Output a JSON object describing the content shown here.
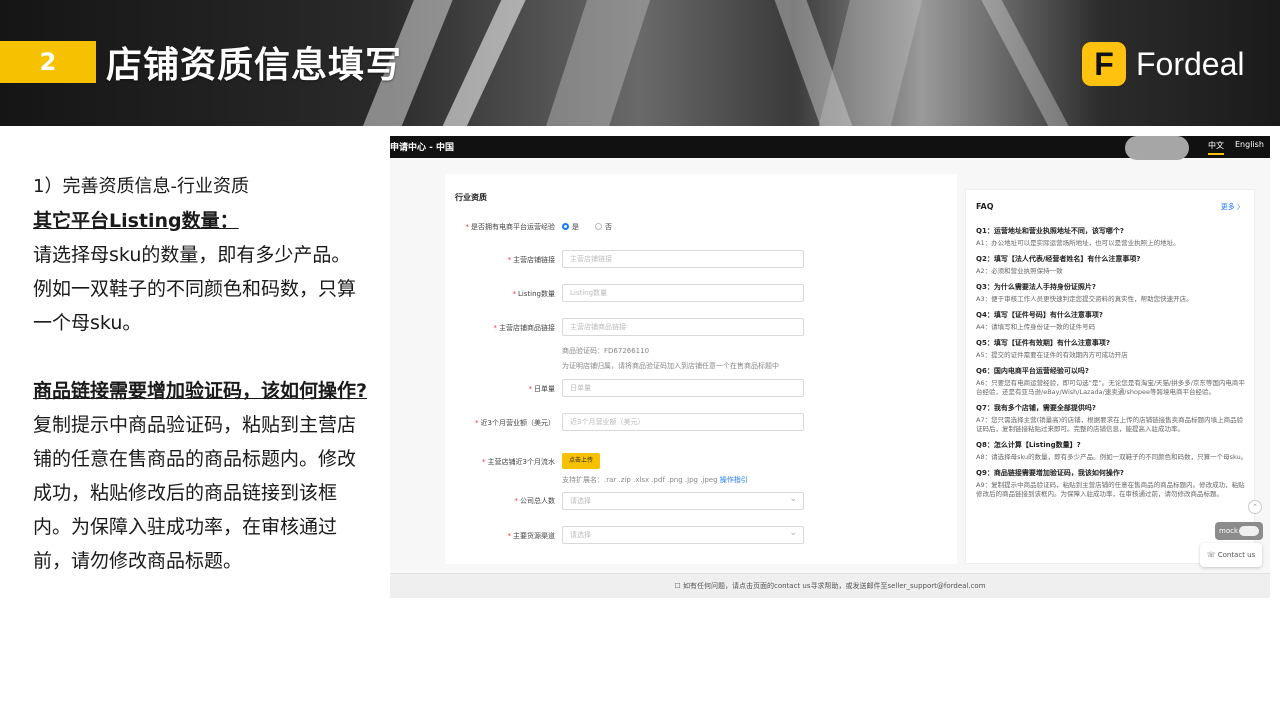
{
  "header": {
    "section_number": "2",
    "section_title": "店铺资质信息填写",
    "logo_mark": "F",
    "logo_text": "Fordeal",
    "accent_color": "#f6c200"
  },
  "left": {
    "subtitle": "1）完善资质信息-行业资质",
    "heading1": "其它平台Listing数量：",
    "body1": "请选择母sku的数量，即有多少产品。例如一双鞋子的不同颜色和码数，只算一个母sku。",
    "heading2": "商品链接需要增加验证码，该如何操作?",
    "body2": "复制提示中商品验证码，粘贴到主营店铺的任意在售商品的商品标题内。修改成功，粘贴修改后的商品链接到该框内。为保障入驻成功率，在审核通过前，请勿修改商品标题。"
  },
  "screenshot": {
    "topbar_title": "申请中心 - 中国",
    "lang_zh": "中文",
    "lang_en": "English",
    "form": {
      "section": "行业资质",
      "q_experience": "是否拥有电商平台运营经验",
      "yes": "是",
      "no": "否",
      "store_link_label": "主营店铺链接",
      "store_link_ph": "主营店铺链接",
      "listing_label": "Listing数量",
      "listing_ph": "Listing数量",
      "product_link_label": "主营店铺商品链接",
      "product_link_ph": "主营店铺商品链接",
      "verify_code": "商品验证码：FD67266110",
      "verify_hint": "为证明店铺归属，请将商品验证码加入到店铺任意一个在售商品标题中",
      "daily_orders_label": "日单量",
      "daily_orders_ph": "日单量",
      "revenue_label": "近3个月营业额（美元）",
      "revenue_ph": "近3个月营业额（美元）",
      "statement_label": "主营店铺近3个月流水",
      "upload_btn": "点击上传",
      "ext_hint": "支持扩展名：.rar .zip .xlsx .pdf .png .jpg .jpeg",
      "ext_link": "操作指引",
      "staff_label": "公司总人数",
      "staff_ph": "请选择",
      "channel_label": "主要货源渠道",
      "channel_ph": "请选择"
    },
    "faq": {
      "title": "FAQ",
      "more": "更多 〉",
      "items": [
        {
          "q": "Q1：运营地址和营业执照地址不同，该写哪个?",
          "a": "A1：办公地址可以是实际运营场所地址，也可以是营业执照上的地址。"
        },
        {
          "q": "Q2：填写【法人代表/经营者姓名】有什么注意事项?",
          "a": "A2：必须和营业执照保持一致"
        },
        {
          "q": "Q3：为什么需要法人手持身份证照片?",
          "a": "A3：便于审核工作人员更快速判定您提交资料的真实性，帮助您快速开店。"
        },
        {
          "q": "Q4：填写【证件号码】有什么注意事项?",
          "a": "A4：请填写和上传身份证一致的证件号码"
        },
        {
          "q": "Q5：填写【证件有效期】有什么注意事项?",
          "a": "A5：提交的证件需要在证件的有效期内方可成功开店"
        },
        {
          "q": "Q6：国内电商平台运营经验可以吗?",
          "a": "A6：只要您有电商运营经验，即可勾选“是”。无论您是有淘宝/天猫/拼多多/京东等国内电商平台经验，还是有亚马逊/eBay/Wish/Lazada/速卖通/shopee等跨境电商平台经验。"
        },
        {
          "q": "Q7：我有多个店铺，需要全部提供吗?",
          "a": "A7：您只需选择主营(销量高)的店铺，根据要求在上传的店铺链接售卖商品标题内填上商品验证码后，复制链接粘贴过来即可。完整的店铺信息，能提高入驻成功率。"
        },
        {
          "q": "Q8：怎么计算【Listing数量】?",
          "a": "A8：请选择母sku的数量，即有多少产品。例如一双鞋子的不同颜色和码数，只算一个母sku。"
        },
        {
          "q": "Q9：商品链接需要增加验证码，我该如何操作?",
          "a": "A9：复制提示中商品验证码，粘贴到主营店铺的任意在售商品的商品标题内。修改成功，粘贴修改后的商品链接到该框内。为保障入驻成功率，在审核通过前，请勿修改商品标题。"
        }
      ]
    },
    "mock_label": "mock",
    "contact_label": "Contact us",
    "footer": "如有任何问题，请点击页面的contact us寻求帮助，或发送邮件至seller_support@fordeal.com"
  }
}
